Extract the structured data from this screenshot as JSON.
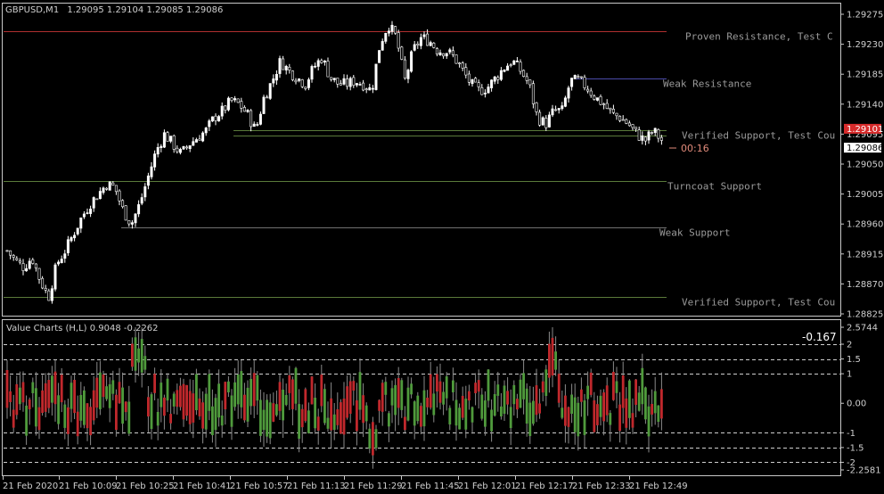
{
  "header": {
    "symbol": "GBPUSD,M1",
    "ohlc": "1.29095 1.29104 1.29085 1.29086"
  },
  "indicator_header": {
    "title": "Value Charts (H,L) 0.9048 -0.2262"
  },
  "countdown": "00:16",
  "vc_current_value": "-0.167",
  "colors": {
    "background": "#000000",
    "frame": "#c8c8c8",
    "bull_candle": "#ffffff",
    "resistance_line": "#b03030",
    "weak_resistance_line": "#4a4aa8",
    "support_line": "#5a7a3a",
    "weak_support_line": "#707070",
    "vc_bull": "#4f9a3c",
    "vc_bear": "#c0282c",
    "bid_tag": "#d62b2b",
    "countdown": "#e08a7a"
  },
  "chart_data": [
    {
      "type": "candlestick",
      "symbol": "GBPUSD",
      "timeframe": "M1",
      "y_axis": {
        "ylim": [
          1.28825,
          1.29275
        ],
        "tick_labels": [
          "1.29275",
          "1.29230",
          "1.29185",
          "1.29140",
          "1.29095",
          "1.29050",
          "1.29005",
          "1.28960",
          "1.28915",
          "1.28870",
          "1.28825"
        ]
      },
      "x_axis": {
        "tick_labels": [
          "21 Feb 2020",
          "21 Feb 10:09",
          "21 Feb 10:25",
          "21 Feb 10:41",
          "21 Feb 10:57",
          "21 Feb 11:13",
          "21 Feb 11:29",
          "21 Feb 11:45",
          "21 Feb 12:01",
          "21 Feb 12:17",
          "21 Feb 12:33",
          "21 Feb 12:49"
        ]
      },
      "price_tags": [
        {
          "value": "1.29101",
          "kind": "ask"
        },
        {
          "value": "1.29086",
          "kind": "bid"
        }
      ],
      "zones": [
        {
          "label": "Proven Resistance, Test C",
          "price": 1.2925,
          "kind": "proven_resistance"
        },
        {
          "label": "Weak Resistance",
          "price": 1.29178,
          "kind": "weak_resistance"
        },
        {
          "label": "Verified Support, Test Cou",
          "price": 1.29101,
          "low": 1.29093,
          "kind": "verified_support"
        },
        {
          "label": "Turncoat Support",
          "price": 1.29025,
          "kind": "turncoat_support"
        },
        {
          "label": "Weak Support",
          "price": 1.28955,
          "kind": "weak_support"
        },
        {
          "label": "Verified Support, Test Cou",
          "price": 1.2885,
          "kind": "verified_support"
        }
      ],
      "close_path": [
        1.2892,
        1.28905,
        1.28895,
        1.2891,
        1.28875,
        1.2885,
        1.289,
        1.2892,
        1.28945,
        1.2897,
        1.2899,
        1.29005,
        1.2902,
        1.29015,
        1.2898,
        1.2896,
        1.2899,
        1.2903,
        1.2907,
        1.29095,
        1.2908,
        1.29065,
        1.2908,
        1.2909,
        1.291,
        1.2912,
        1.2913,
        1.29145,
        1.2914,
        1.29125,
        1.291,
        1.2915,
        1.29175,
        1.29205,
        1.2919,
        1.2918,
        1.2917,
        1.29195,
        1.2921,
        1.2918,
        1.2917,
        1.2917,
        1.29175,
        1.2917,
        1.2916,
        1.2923,
        1.2926,
        1.2924,
        1.29175,
        1.2922,
        1.2924,
        1.29235,
        1.2922,
        1.2922,
        1.2921,
        1.2919,
        1.2917,
        1.2916,
        1.29165,
        1.2918,
        1.29195,
        1.29205,
        1.2919,
        1.2917,
        1.2912,
        1.2911,
        1.2913,
        1.2913,
        1.29175,
        1.29175,
        1.29165,
        1.2915,
        1.2914,
        1.29125,
        1.2912,
        1.2911,
        1.29095,
        1.29085,
        1.291,
        1.29086
      ]
    },
    {
      "type": "bar",
      "name": "Value Charts (H,L)",
      "header_values": [
        0.9048,
        -0.2262
      ],
      "y_axis": {
        "ylim": [
          -2.2581,
          2.5744
        ],
        "tick_labels": [
          "2.5744",
          "2",
          "1.5",
          "1",
          "0.00",
          "-1",
          "-1.5",
          "-2",
          "-2.2581"
        ],
        "dashed_levels": [
          2,
          1.5,
          1,
          -1,
          -1.5,
          -2
        ]
      },
      "current_value": -0.167
    }
  ]
}
